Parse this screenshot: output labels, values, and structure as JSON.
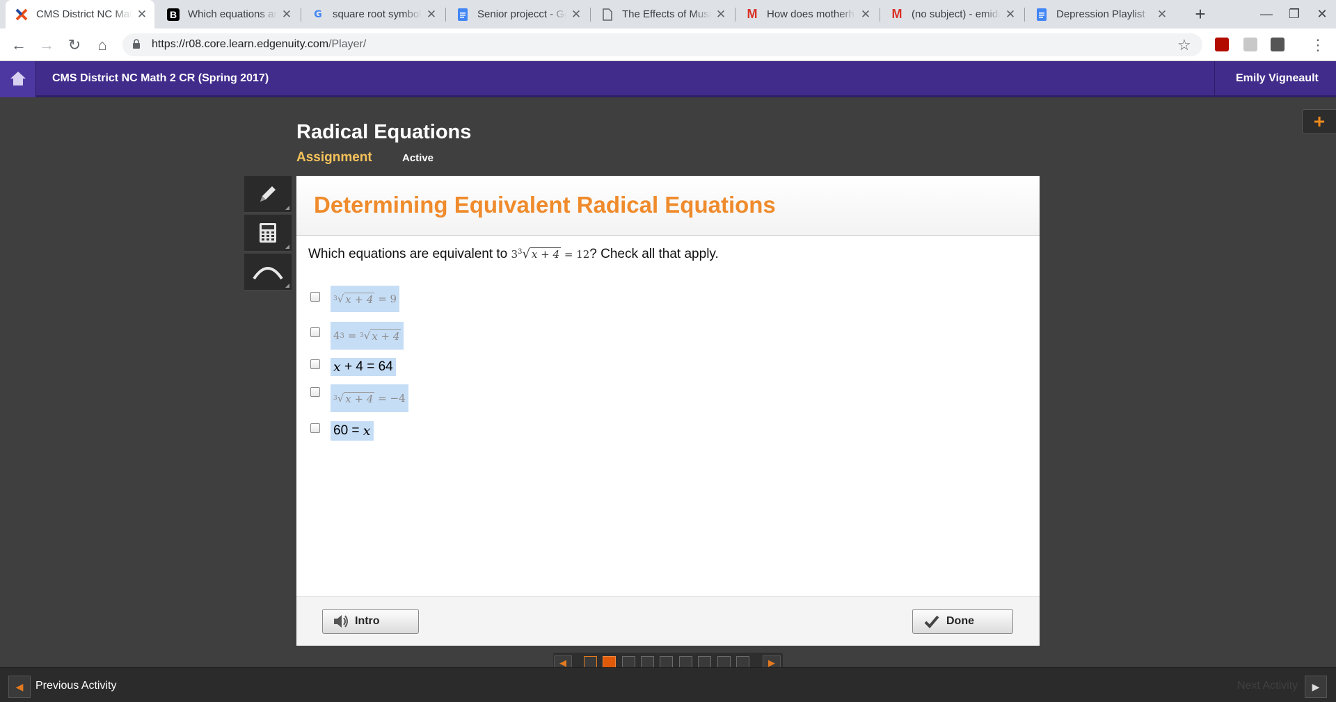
{
  "browser": {
    "tabs": [
      {
        "title": "CMS District NC Math",
        "icon": "edgenuity-x-icon",
        "active": true
      },
      {
        "title": "Which equations are",
        "icon": "brainly-b-icon"
      },
      {
        "title": "square root symbol",
        "icon": "google-g-icon"
      },
      {
        "title": "Senior projecct - Go",
        "icon": "docs-icon"
      },
      {
        "title": "The Effects of Music",
        "icon": "file-icon"
      },
      {
        "title": "How does motherh",
        "icon": "gmail-icon"
      },
      {
        "title": "(no subject) - emida",
        "icon": "gmail-icon"
      },
      {
        "title": "Depression Playlist",
        "icon": "docs-icon"
      }
    ],
    "url_host": "https://r08.core.learn.edgenuity.com",
    "url_path": "/Player/"
  },
  "header": {
    "course": "CMS District NC Math 2 CR (Spring 2017)",
    "user": "Emily Vigneault"
  },
  "lesson": {
    "title": "Radical Equations",
    "type": "Assignment",
    "status": "Active"
  },
  "card": {
    "title": "Determining Equivalent Radical Equations",
    "question_prefix": "Which equations are equivalent to",
    "question_expr": {
      "coef": "3",
      "index": "3",
      "radicand": "x + 4",
      "rhs": "= 12"
    },
    "question_suffix": "? Check all that apply.",
    "options": [
      {
        "index": "3",
        "radicand": "x + 4",
        "rhs": "= 9"
      },
      {
        "lhs": "4",
        "exp": "3",
        "index": "3",
        "radicand": "x + 4"
      },
      {
        "var": "x",
        "text": "+ 4 = 64"
      },
      {
        "index": "3",
        "radicand": "x + 4",
        "rhs": "= −4"
      },
      {
        "text": "60 =",
        "var": "x"
      }
    ],
    "intro_label": "Intro",
    "done_label": "Done"
  },
  "nav": {
    "prev_label": "Previous Activity",
    "next_label": "Next Activity"
  },
  "colors": {
    "brand_purple": "#412c8b",
    "accent_orange": "#ef8b2c",
    "selection_blue": "#c6ddf6"
  }
}
